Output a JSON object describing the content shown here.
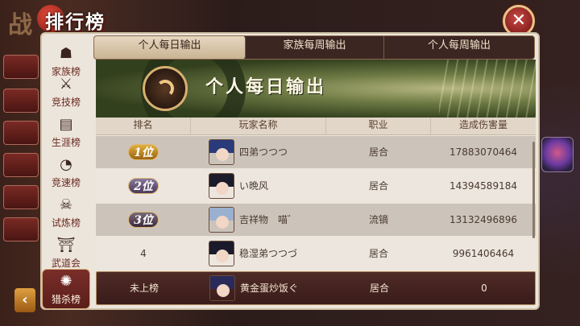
{
  "title": {
    "bg_char": "战",
    "text": "排行榜"
  },
  "close_glyph": "✕",
  "sidebar": {
    "items": [
      {
        "label": "家族榜",
        "icon": "family-icon",
        "glyph": "☗"
      },
      {
        "label": "竞技榜",
        "icon": "crossed-swords-icon",
        "glyph": "⚔"
      },
      {
        "label": "生涯榜",
        "icon": "book-icon",
        "glyph": "▤"
      },
      {
        "label": "竞速榜",
        "icon": "stopwatch-icon",
        "glyph": "◔"
      },
      {
        "label": "试炼榜",
        "icon": "demon-mask-icon",
        "glyph": "☠"
      },
      {
        "label": "武道会",
        "icon": "dojo-icon",
        "glyph": "⛩"
      },
      {
        "label": "猎杀榜",
        "icon": "hunt-emblem-icon",
        "glyph": "✺",
        "active": true
      }
    ]
  },
  "tabs": [
    {
      "label": "个人每日输出",
      "active": true
    },
    {
      "label": "家族每周输出",
      "active": false
    },
    {
      "label": "个人每周输出",
      "active": false
    }
  ],
  "banner": {
    "title": "个人每日输出"
  },
  "table": {
    "headers": [
      "排名",
      "玩家名称",
      "职业",
      "造成伤害量"
    ],
    "rows": [
      {
        "rank": "1位",
        "rank_style": "r1",
        "name": "四弟つつつ",
        "class": "居合",
        "damage": "17883070464",
        "avatar_hair": "#2a3a7a"
      },
      {
        "rank": "2位",
        "rank_style": "r2",
        "name": "い晩风",
        "class": "居合",
        "damage": "14394589184",
        "avatar_hair": "#1a1a2a"
      },
      {
        "rank": "3位",
        "rank_style": "r3",
        "name": "吉祥物　喵゛",
        "class": "流镝",
        "damage": "13132496896",
        "avatar_hair": "#9ab0d0"
      },
      {
        "rank": "4",
        "rank_style": "plain",
        "name": "稳湿弟つつづ",
        "class": "居合",
        "damage": "9961406464",
        "avatar_hair": "#1a1a2a"
      }
    ],
    "self": {
      "rank": "未上榜",
      "name": "黄金蛋炒饭ぐ",
      "class": "居合",
      "damage": "0",
      "avatar_hair": "#2a2a5a"
    }
  },
  "colors": {
    "accent": "#e7c58a",
    "panel": "#ece5dc",
    "self_row": "#4e2a26"
  }
}
